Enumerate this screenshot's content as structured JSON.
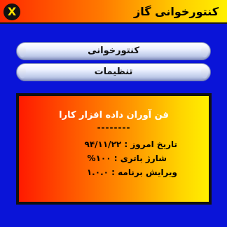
{
  "titlebar": {
    "close_label": "X",
    "title": "کنتورخوانی گاز"
  },
  "menu": {
    "items": [
      {
        "label": "کنتورخوانی"
      },
      {
        "label": "تنظیمات"
      }
    ]
  },
  "info": {
    "app_name": "فن آوران داده افزار کارا",
    "separator": "--------",
    "date_line": "تاریخ امروز : ۹۴/۱۱/۲۲",
    "battery_line": "شارژ باتری : ۱۰۰%",
    "version_line": "ویرایش برنامه : ۱.۰.۰"
  },
  "colors": {
    "background": "#0a14d8",
    "title_gradient_start": "#ff2a00",
    "title_gradient_end": "#fff000",
    "panel_gradient_start": "#ff1a00",
    "panel_gradient_end": "#ffef00"
  }
}
